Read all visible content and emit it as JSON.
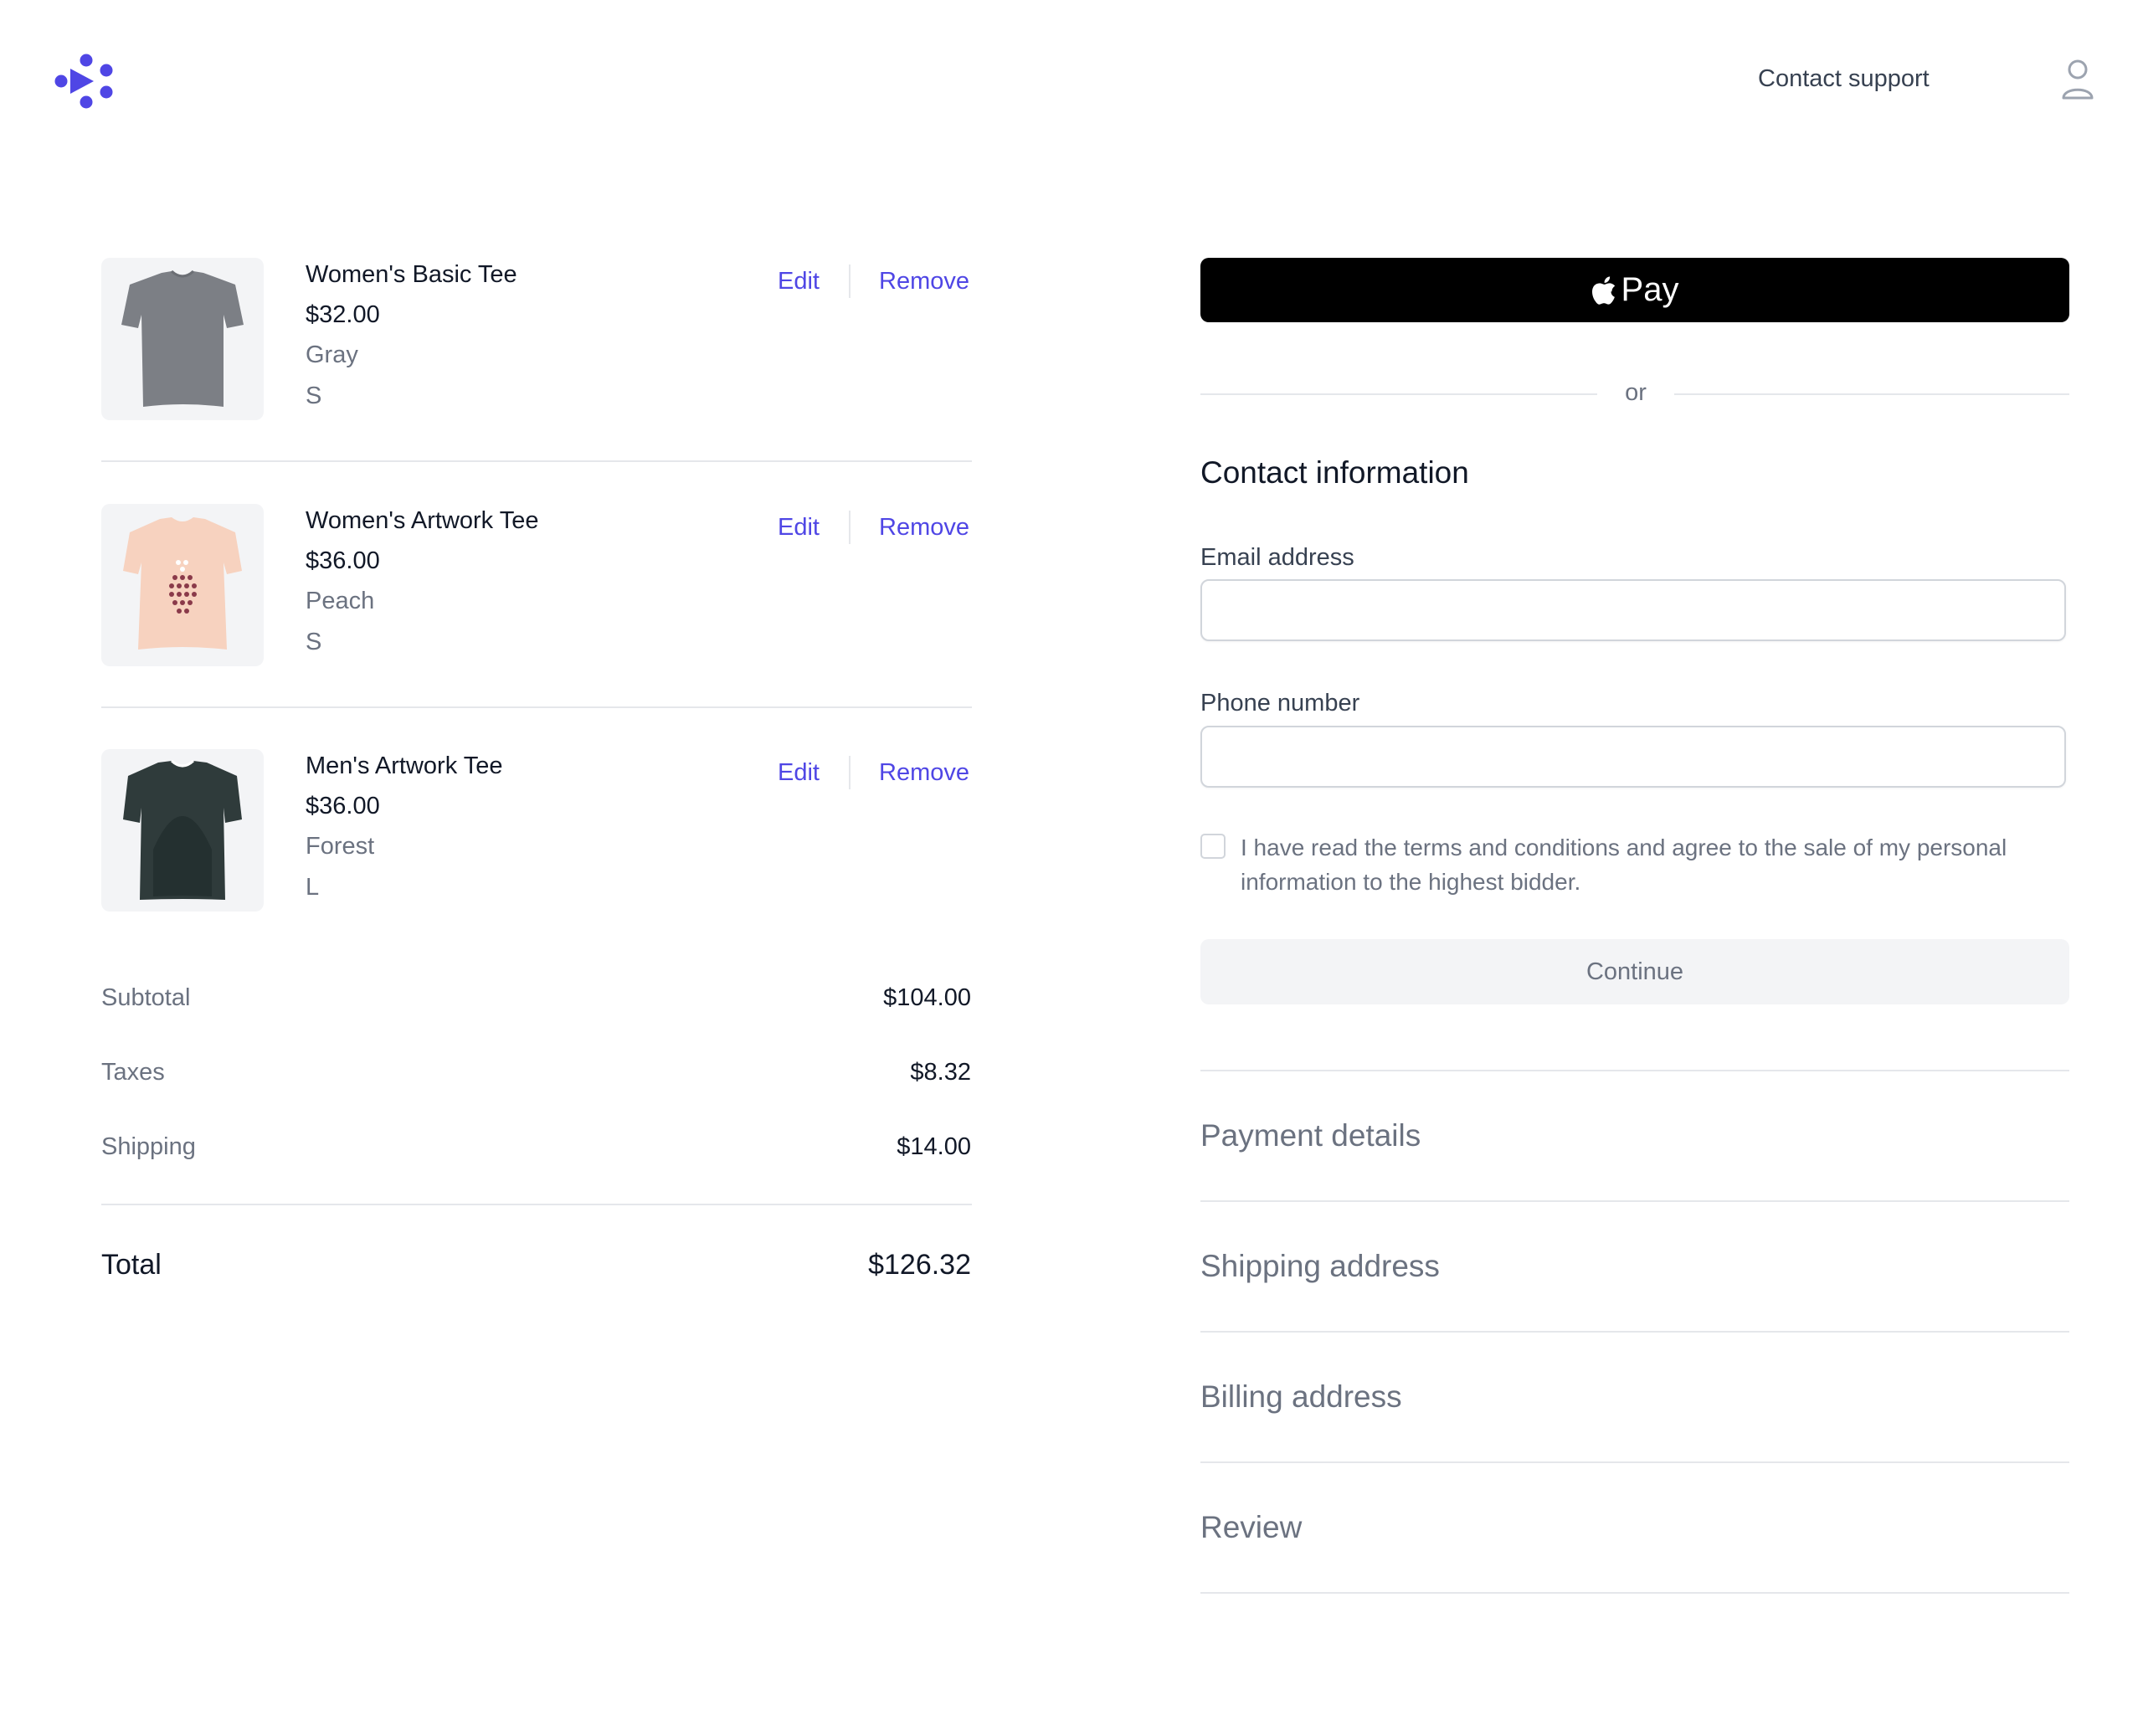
{
  "header": {
    "logo_icon": "brand-logo-icon",
    "support_label": "Contact support",
    "user_icon": "user-icon",
    "brand_color": "#4f46e5"
  },
  "cart": {
    "items": [
      {
        "name": "Women's Basic Tee",
        "price": "$32.00",
        "color": "Gray",
        "size": "S",
        "edit": "Edit",
        "remove": "Remove"
      },
      {
        "name": "Women's Artwork Tee",
        "price": "$36.00",
        "color": "Peach",
        "size": "S",
        "edit": "Edit",
        "remove": "Remove"
      },
      {
        "name": "Men's Artwork Tee",
        "price": "$36.00",
        "color": "Forest",
        "size": "L",
        "edit": "Edit",
        "remove": "Remove"
      }
    ],
    "summary": {
      "subtotal_label": "Subtotal",
      "subtotal": "$104.00",
      "taxes_label": "Taxes",
      "taxes": "$8.32",
      "shipping_label": "Shipping",
      "shipping": "$14.00",
      "total_label": "Total",
      "total": "$126.32"
    }
  },
  "checkout": {
    "apple_pay_label": "Pay",
    "or_label": "or",
    "contact_title": "Contact information",
    "email_label": "Email address",
    "email_value": "",
    "phone_label": "Phone number",
    "phone_value": "",
    "terms_text": "I have read the terms and conditions and agree to the sale of my personal information to the highest bidder.",
    "continue_label": "Continue",
    "steps": [
      "Payment details",
      "Shipping address",
      "Billing address",
      "Review"
    ]
  }
}
